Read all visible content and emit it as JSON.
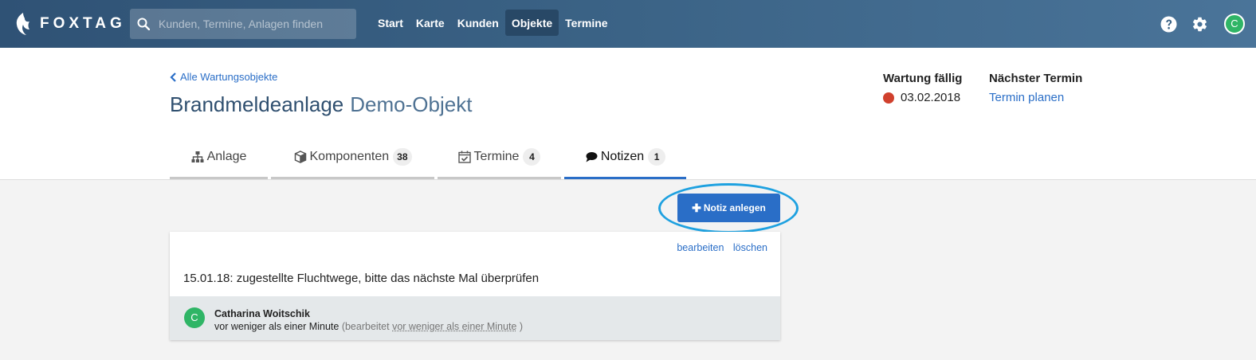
{
  "navbar": {
    "brand": "FOXTAG",
    "search_placeholder": "Kunden, Termine, Anlagen finden",
    "links": [
      "Start",
      "Karte",
      "Kunden",
      "Objekte",
      "Termine"
    ],
    "active_link": "Objekte",
    "user_initial": "C"
  },
  "header": {
    "back_label": "Alle Wartungsobjekte",
    "title": "Brandmeldeanlage",
    "subtitle": "Demo-Objekt",
    "maintenance_label": "Wartung fällig",
    "maintenance_date": "03.02.2018",
    "maintenance_status_color": "#d0402d",
    "next_label": "Nächster Termin",
    "next_link": "Termin planen"
  },
  "tabs": [
    {
      "label": "Anlage",
      "icon": "sitemap-icon",
      "count": null
    },
    {
      "label": "Komponenten",
      "icon": "cube-icon",
      "count": "38"
    },
    {
      "label": "Termine",
      "icon": "calendar-check-icon",
      "count": "4"
    },
    {
      "label": "Notizen",
      "icon": "comment-icon",
      "count": "1",
      "active": true
    }
  ],
  "main": {
    "add_note_label": "Notiz anlegen",
    "note": {
      "edit_label": "bearbeiten",
      "delete_label": "löschen",
      "text": "15.01.18: zugestellte Fluchtwege, bitte das nächste Mal überprüfen",
      "author_initial": "C",
      "author_name": "Catharina Woitschik",
      "created": "vor weniger als einer Minute",
      "edited_prefix": "(bearbeitet",
      "edited_time": "vor weniger als einer Minute",
      "edited_suffix": ")"
    }
  },
  "colors": {
    "accent": "#2a6ec7",
    "navbar": "#3b6386",
    "avatar": "#2fb566",
    "highlight": "#1ea1e0"
  }
}
